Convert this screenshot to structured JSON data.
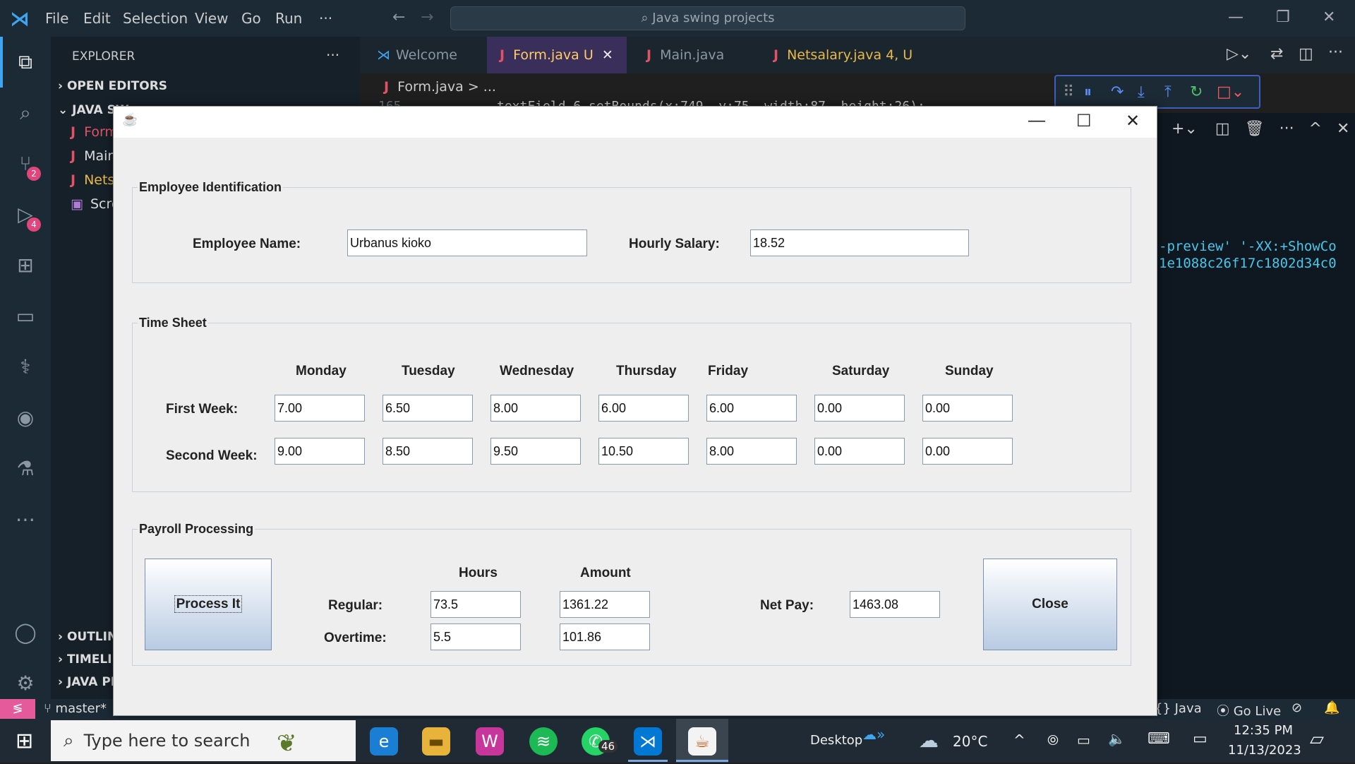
{
  "vscode": {
    "menu": [
      "File",
      "Edit",
      "Selection",
      "View",
      "Go",
      "Run",
      "···"
    ],
    "command_center": "Java swing projects",
    "explorer_title": "EXPLORER",
    "explorer_more": "···",
    "sections": {
      "open_editors": "OPEN EDITORS",
      "project": "JAVA SW",
      "outline": "OUTLIN",
      "timeline": "TIMELI",
      "java_projects": "JAVA PI"
    },
    "files": [
      {
        "label": "Form",
        "icon": "J",
        "color": "#e35166"
      },
      {
        "label": "Main",
        "icon": "J",
        "color": "#dddddd"
      },
      {
        "label": "Nets",
        "icon": "J",
        "color": "#e8b84a"
      },
      {
        "label": "Scre",
        "icon": "▣",
        "color": "#dddddd"
      }
    ],
    "tabs": [
      {
        "label": "Welcome"
      },
      {
        "label": "Form.java",
        "suffix": "U"
      },
      {
        "label": "Main.java"
      },
      {
        "label": "Netsalary.java",
        "suffix": "4, U"
      }
    ],
    "breadcrumb": "Form.java > ...",
    "code_line_number": "165",
    "code_line": "textField_6.setBounds(x:749, y:75, width:87, height:26);",
    "terminal_lines": [
      "-preview' '-XX:+ShowCo",
      "1e1088c26f17c1802d34c0"
    ],
    "badges": {
      "source_control": "2",
      "debug": "4"
    },
    "status": {
      "branch": "master*",
      "language": "{} Java",
      "go_live": "Go Live"
    }
  },
  "swing_form": {
    "employee_identification": {
      "title": "Employee Identification",
      "name_label": "Employee Name:",
      "name_value": "Urbanus kioko",
      "salary_label": "Hourly Salary:",
      "salary_value": "18.52"
    },
    "time_sheet": {
      "title": "Time Sheet",
      "days": [
        "Monday",
        "Tuesday",
        "Wednesday",
        "Thursday",
        "Friday",
        "Saturday",
        "Sunday"
      ],
      "first_week_label": "First Week:",
      "first_week": [
        "7.00",
        "6.50",
        "8.00",
        "6.00",
        "6.00",
        "0.00",
        "0.00"
      ],
      "second_week_label": "Second Week:",
      "second_week": [
        "9.00",
        "8.50",
        "9.50",
        "10.50",
        "8.00",
        "0.00",
        "0.00"
      ]
    },
    "payroll": {
      "title": "Payroll Processing",
      "process_button": "Process It",
      "hours_header": "Hours",
      "amount_header": "Amount",
      "regular_label": "Regular:",
      "regular_hours": "73.5",
      "regular_amount": "1361.22",
      "overtime_label": "Overtime:",
      "overtime_hours": "5.5",
      "overtime_amount": "101.86",
      "net_pay_label": "Net Pay:",
      "net_pay": "1463.08",
      "close_button": "Close"
    }
  },
  "taskbar": {
    "search_placeholder": "Type here to search",
    "whatsapp_badge": "46",
    "desktop_label": "Desktop",
    "weather": "20°C",
    "time": "12:35 PM",
    "date": "11/13/2023"
  }
}
